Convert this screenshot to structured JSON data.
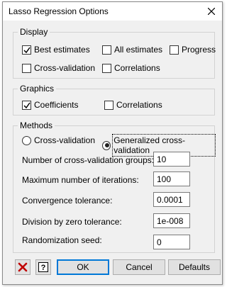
{
  "window": {
    "title": "Lasso Regression Options"
  },
  "display": {
    "label": "Display",
    "best_estimates": {
      "label": "Best estimates",
      "checked": true
    },
    "all_estimates": {
      "label": "All estimates",
      "checked": false
    },
    "progress": {
      "label": "Progress",
      "checked": false
    },
    "cross_validation": {
      "label": "Cross-validation",
      "checked": false
    },
    "correlations": {
      "label": "Correlations",
      "checked": false
    }
  },
  "graphics": {
    "label": "Graphics",
    "coefficients": {
      "label": "Coefficients",
      "checked": true
    },
    "correlations": {
      "label": "Correlations",
      "checked": false
    }
  },
  "methods": {
    "label": "Methods",
    "cross_validation": {
      "label": "Cross-validation",
      "selected": false
    },
    "generalized_cv": {
      "label": "Generalized cross-validation",
      "selected": true
    },
    "num_groups": {
      "label": "Number of cross-validation groups:",
      "value": "10"
    },
    "max_iterations": {
      "label": "Maximum number of iterations:",
      "value": "100"
    },
    "convergence": {
      "label": "Convergence tolerance:",
      "value": "0.0001"
    },
    "div_zero": {
      "label": "Division by zero tolerance:",
      "value": "1e-008"
    },
    "seed": {
      "label": "Randomization seed:",
      "value": "0"
    }
  },
  "buttons": {
    "ok": "OK",
    "cancel": "Cancel",
    "defaults": "Defaults"
  },
  "icons": {
    "close": "close-icon",
    "clear": "red-x-icon",
    "help": "help-icon"
  },
  "colors": {
    "accent": "#0078d7",
    "clear_red": "#c00000",
    "background": "#f0f0f0"
  }
}
